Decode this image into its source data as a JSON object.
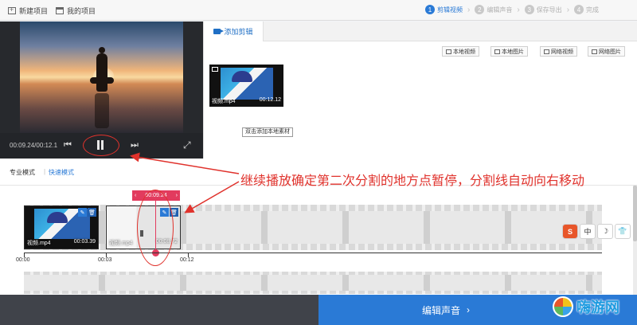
{
  "topbar": {
    "new_project": "新建项目",
    "my_projects": "我的项目",
    "steps": [
      {
        "num": "1",
        "label": "剪辑视频",
        "active": true
      },
      {
        "num": "2",
        "label": "编辑声音",
        "active": false
      },
      {
        "num": "3",
        "label": "保存导出",
        "active": false
      },
      {
        "num": "4",
        "label": "完成",
        "active": false
      }
    ]
  },
  "preview": {
    "time": "00:09.24/00:12.1"
  },
  "assets": {
    "tab_label": "添加剪辑",
    "sources": [
      "本地视频",
      "本地图片",
      "网络视频",
      "网络图片"
    ],
    "thumb": {
      "name": "视频.mp4",
      "duration": "00:12.12"
    },
    "tooltip": "双击添加本地素材"
  },
  "modes": {
    "pro": "专业模式",
    "sep": "|",
    "fast": "快速模式"
  },
  "annotation": "继续播放确定第二次分割的地方点暂停，分割线自动向右移动",
  "timeline": {
    "playhead_time": "00:09.24",
    "clips": [
      {
        "name": "视频.mp4",
        "duration": "00:03.39"
      },
      {
        "name": "视频.mp4",
        "duration": "00:08.72"
      }
    ],
    "ruler": [
      "00:00",
      "00:03",
      "00:12"
    ]
  },
  "ime": [
    "S",
    "中",
    "☽",
    "👕"
  ],
  "bottom": {
    "edit_audio": "编辑声音"
  },
  "watermark": "嗨游网",
  "colors": {
    "accent": "#2a7ad6",
    "annotation": "#e0322c",
    "playhead": "#e23b5e"
  }
}
